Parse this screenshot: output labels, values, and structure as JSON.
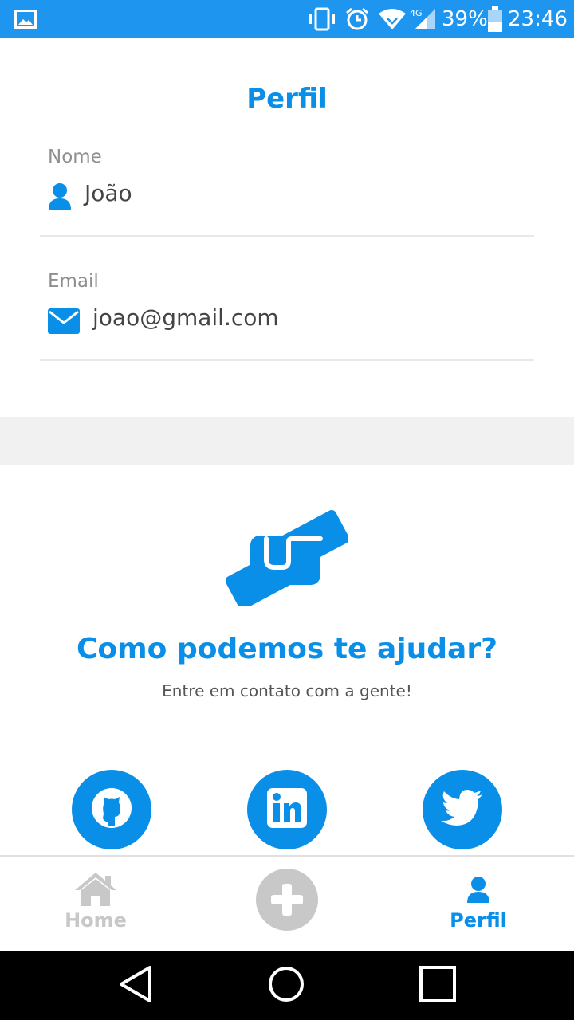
{
  "status_bar": {
    "battery": "39%",
    "time": "23:46",
    "network": "4G"
  },
  "profile": {
    "title": "Perfil",
    "name_label": "Nome",
    "name_value": "João",
    "email_label": "Email",
    "email_value": "joao@gmail.com"
  },
  "help": {
    "title": "Como podemos te ajudar?",
    "subtitle": "Entre em contato com a gente!"
  },
  "social": [
    {
      "icon": "github-icon"
    },
    {
      "icon": "linkedin-icon"
    },
    {
      "icon": "twitter-icon"
    }
  ],
  "bottom_nav": {
    "home_label": "Home",
    "profile_label": "Perfil",
    "active": "Perfil"
  },
  "colors": {
    "accent": "#0a8fe8",
    "status_bar": "#1e96f0",
    "inactive": "#c8c8c8"
  }
}
